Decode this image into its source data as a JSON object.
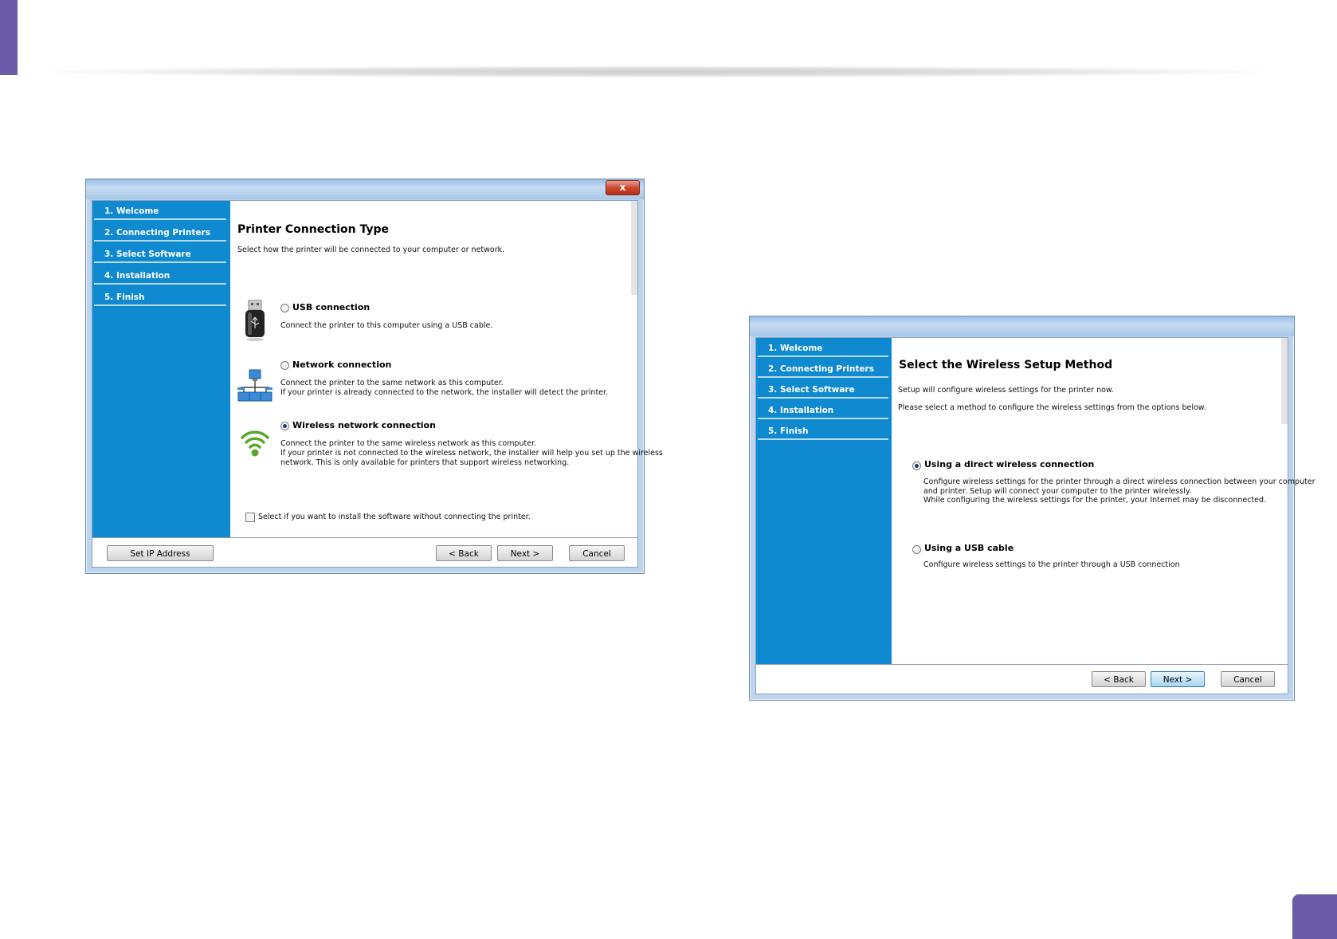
{
  "window1": {
    "close_symbol": "x",
    "steps": [
      "1. Welcome",
      "2. Connecting Printers",
      "3. Select Software",
      "4. Installation",
      "5. Finish"
    ],
    "title": "Printer Connection Type",
    "subtitle": "Select how the printer will be connected to your computer or network.",
    "options": [
      {
        "label": "USB connection",
        "selected": false,
        "icon": "usb-icon",
        "lines": [
          "Connect the printer to this computer using a USB cable."
        ]
      },
      {
        "label": "Network connection",
        "selected": false,
        "icon": "network-icon",
        "lines": [
          "Connect the printer to the same network as this computer.",
          "If your printer is already connected to the network, the installer will detect the printer."
        ]
      },
      {
        "label": "Wireless network connection",
        "selected": true,
        "icon": "wifi-icon",
        "lines": [
          "Connect the printer to the same wireless network as this computer.",
          "If your printer is not connected to the wireless network, the installer will help you set up the wireless",
          "network. This is only available for printers that support wireless networking."
        ]
      }
    ],
    "checkbox_label": "Select if you want to install the software without connecting the printer.",
    "buttons": {
      "set_ip": "Set IP Address",
      "back": "< Back",
      "next": "Next >",
      "cancel": "Cancel"
    }
  },
  "window2": {
    "steps": [
      "1. Welcome",
      "2. Connecting Printers",
      "3. Select Software",
      "4. Installation",
      "5. Finish"
    ],
    "title": "Select the Wireless Setup Method",
    "intro": [
      "Setup will configure wireless settings for the printer now.",
      "Please select a method to configure the wireless settings from the options below."
    ],
    "options": [
      {
        "label": "Using a direct wireless connection",
        "selected": true,
        "lines": [
          "Configure wireless settings for the printer through a direct wireless connection between your computer",
          "and printer. Setup will connect your computer to the printer wirelessly.",
          "While configuring the wireless settings for the printer, your Internet may be disconnected."
        ]
      },
      {
        "label": "Using a USB cable",
        "selected": false,
        "lines": [
          "Configure wireless settings to the printer through a USB connection"
        ]
      }
    ],
    "buttons": {
      "back": "< Back",
      "next": "Next >",
      "cancel": "Cancel"
    }
  },
  "colors": {
    "accent": "#6a5aa8",
    "sidebar": "#0f89cf"
  }
}
